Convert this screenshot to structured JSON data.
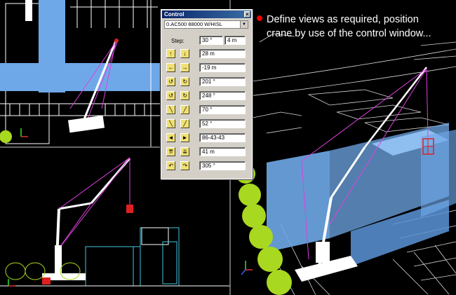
{
  "note": {
    "line1": "Define views as required, position",
    "line2": "crane by use of the control window..."
  },
  "control_window": {
    "title": "Control",
    "close_glyph": "×",
    "crane_select": {
      "value": "0.AC500      88000 W/HISL",
      "arrow": "▼"
    },
    "step_label": "Step:",
    "step_angle": "30 °",
    "step_length": "4 m",
    "rows": [
      {
        "left_icon": "up-arrow-icon",
        "right_icon": "down-arrow-icon",
        "left_glyph": "↑",
        "right_glyph": "↓",
        "value": "28 m"
      },
      {
        "left_icon": "left-arrow-icon",
        "right_icon": "right-arrow-icon",
        "left_glyph": "←",
        "right_glyph": "→",
        "value": "-19 m"
      },
      {
        "left_icon": "rotate-ccw-icon",
        "right_icon": "rotate-cw-icon",
        "left_glyph": "↺",
        "right_glyph": "↻",
        "value": "201 °"
      },
      {
        "left_icon": "slew-ccw-icon",
        "right_icon": "slew-cw-icon",
        "left_glyph": "↺",
        "right_glyph": "↻",
        "value": "248 °"
      },
      {
        "left_icon": "boom-lower-icon",
        "right_icon": "boom-raise-icon",
        "left_glyph": "╲",
        "right_glyph": "╱",
        "value": "70 °"
      },
      {
        "left_icon": "jib-lower-icon",
        "right_icon": "jib-raise-icon",
        "left_glyph": "╲",
        "right_glyph": "╱",
        "value": "52 °"
      },
      {
        "left_icon": "configuration-prev-icon",
        "right_icon": "configuration-next-icon",
        "left_glyph": "◄",
        "right_glyph": "►",
        "value": "86-43-43"
      },
      {
        "left_icon": "hook-raise-icon",
        "right_icon": "hook-lower-icon",
        "left_glyph": "⇈",
        "right_glyph": "⇊",
        "value": "41 m"
      },
      {
        "left_icon": "hook-rotate-left-icon",
        "right_icon": "hook-rotate-right-icon",
        "left_glyph": "↶",
        "right_glyph": "↷",
        "value": "305 °"
      }
    ]
  },
  "colors": {
    "building_blue": "#6fa8e8",
    "crane_white": "#ffffff",
    "cable_magenta": "#e040e0",
    "load_red": "#e02020",
    "tree_green": "#a8d820",
    "outline_cyan": "#40c8e0",
    "button_yellow": "#f0e070"
  }
}
